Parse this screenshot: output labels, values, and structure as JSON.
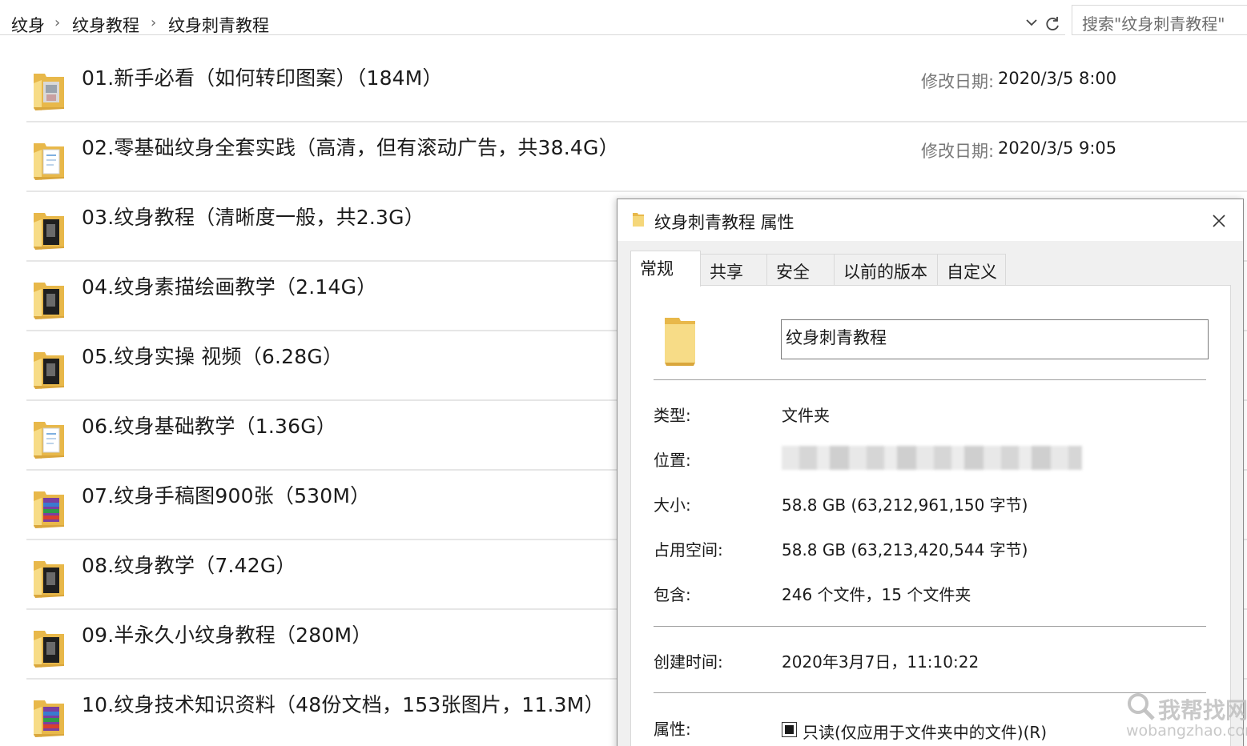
{
  "breadcrumb": [
    "纹身",
    "纹身教程",
    "纹身刺青教程"
  ],
  "search": {
    "placeholder": "搜索\"纹身刺青教程\""
  },
  "list": {
    "date_label": "修改日期:",
    "items": [
      {
        "name": "01.新手必看（如何转印图案）（184M）",
        "date": "2020/3/5 8:00",
        "thumb": "photo"
      },
      {
        "name": "02.零基础纹身全套实践（高清，但有滚动广告，共38.4G）",
        "date": "2020/3/5 9:05",
        "thumb": "doc"
      },
      {
        "name": "03.纹身教程（清晰度一般，共2.3G）",
        "date": "",
        "thumb": "dark"
      },
      {
        "name": "04.纹身素描绘画教学（2.14G）",
        "date": "",
        "thumb": "dark"
      },
      {
        "name": "05.纹身实操 视频（6.28G）",
        "date": "",
        "thumb": "dark"
      },
      {
        "name": "06.纹身基础教学（1.36G）",
        "date": "",
        "thumb": "doc"
      },
      {
        "name": "07.纹身手稿图900张（530M）",
        "date": "",
        "thumb": "rar"
      },
      {
        "name": "08.纹身教学（7.42G）",
        "date": "",
        "thumb": "dark"
      },
      {
        "name": "09.半永久小纹身教程（280M）",
        "date": "",
        "thumb": "dark"
      },
      {
        "name": "10.纹身技术知识资料（48份文档，153张图片，11.3M）",
        "date": "",
        "thumb": "rar"
      }
    ]
  },
  "dialog": {
    "title": "纹身刺青教程 属性",
    "tabs": [
      "常规",
      "共享",
      "安全",
      "以前的版本",
      "自定义"
    ],
    "active_tab": "常规",
    "folder_name": "纹身刺青教程",
    "type_label": "类型:",
    "type_value": "文件夹",
    "location_label": "位置:",
    "size_label": "大小:",
    "size_value": "58.8 GB (63,212,961,150 字节)",
    "disk_label": "占用空间:",
    "disk_value": "58.8 GB (63,213,420,544 字节)",
    "contains_label": "包含:",
    "contains_value": "246 个文件，15 个文件夹",
    "created_label": "创建时间:",
    "created_value": "2020年3月7日，11:10:22",
    "attr_label": "属性:",
    "readonly_label": "只读(仅应用于文件夹中的文件)(R)"
  },
  "watermark": {
    "text": "我帮找网",
    "sub": "wobangzhao.com"
  },
  "colors": {
    "folder": "#f5d77a",
    "folder_dark": "#e8b84a",
    "divider": "#e6e6e6"
  }
}
